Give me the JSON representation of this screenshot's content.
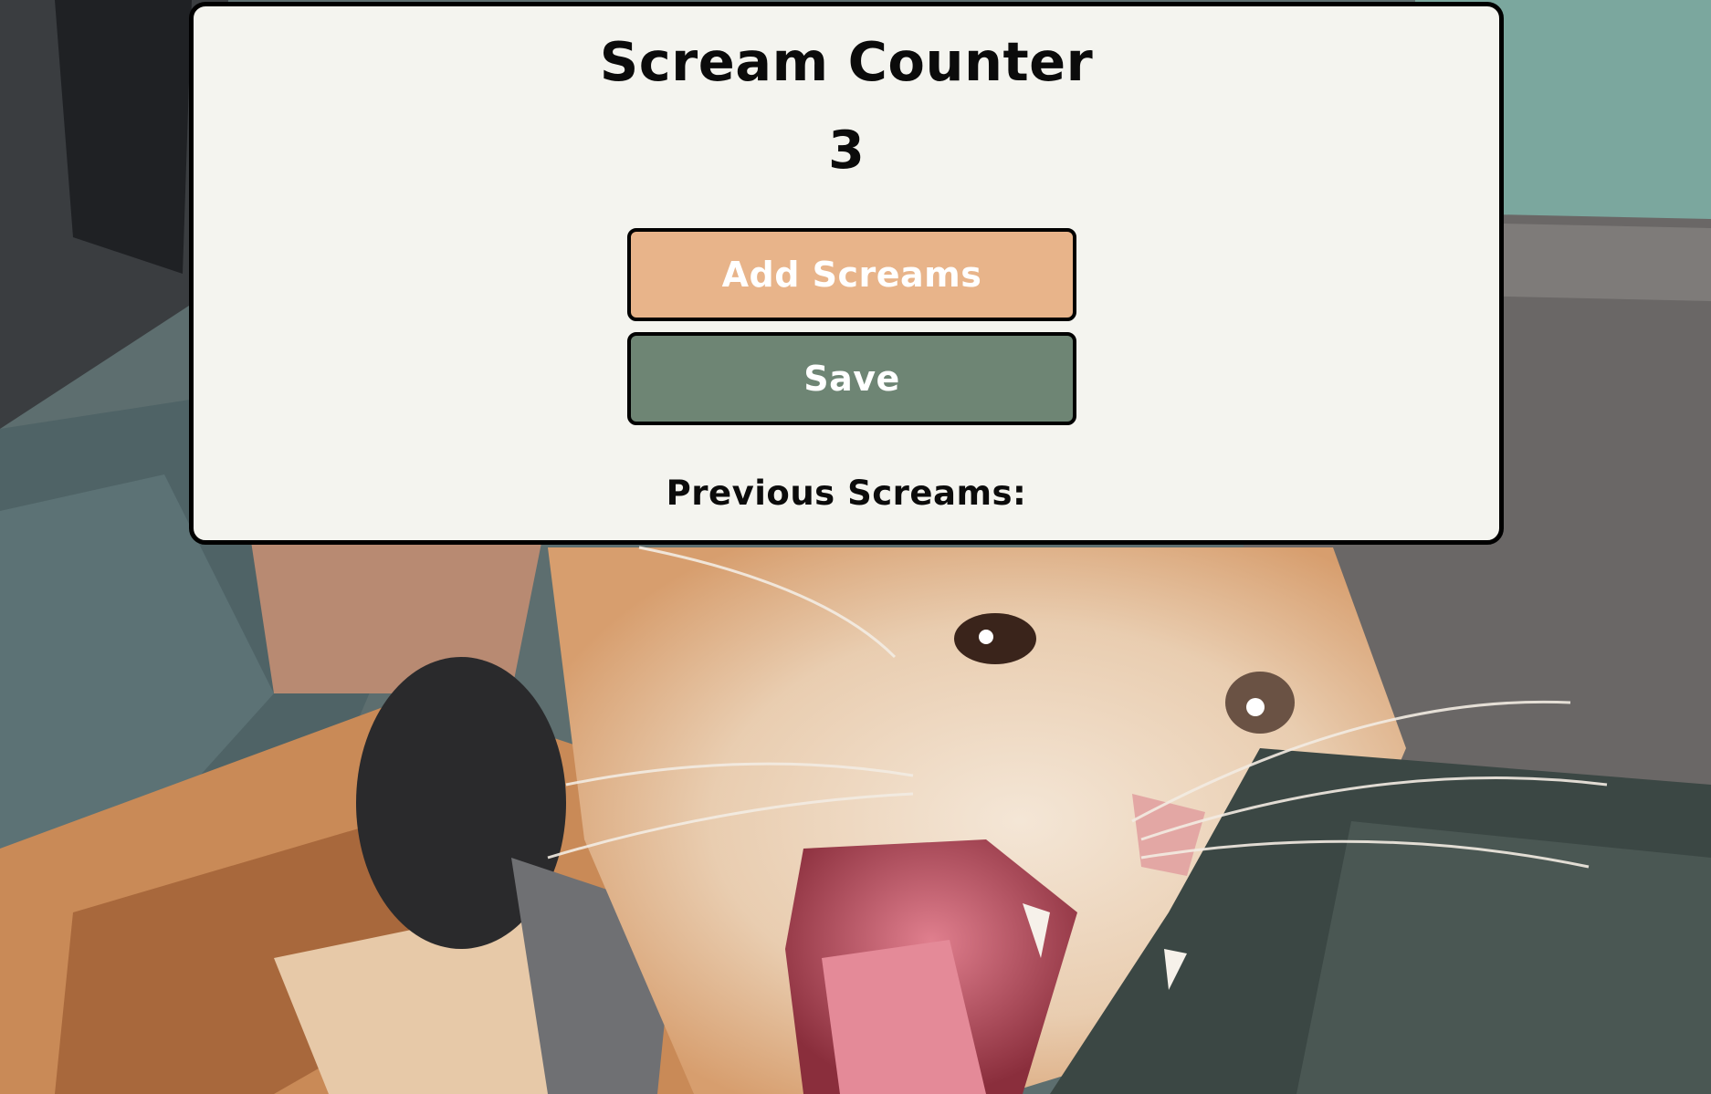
{
  "app": {
    "title": "Scream Counter",
    "count": "3"
  },
  "actions": {
    "add_label": "Add Screams",
    "save_label": "Save"
  },
  "history": {
    "heading": "Previous Screams:",
    "entries": []
  },
  "background": {
    "subject": "screaming orange and white kitten photo"
  },
  "colors": {
    "panel_bg": "#f4f4ef",
    "add_button": "#e8b48a",
    "save_button": "#6e8574",
    "border": "#000000",
    "button_text": "#ffffff"
  }
}
